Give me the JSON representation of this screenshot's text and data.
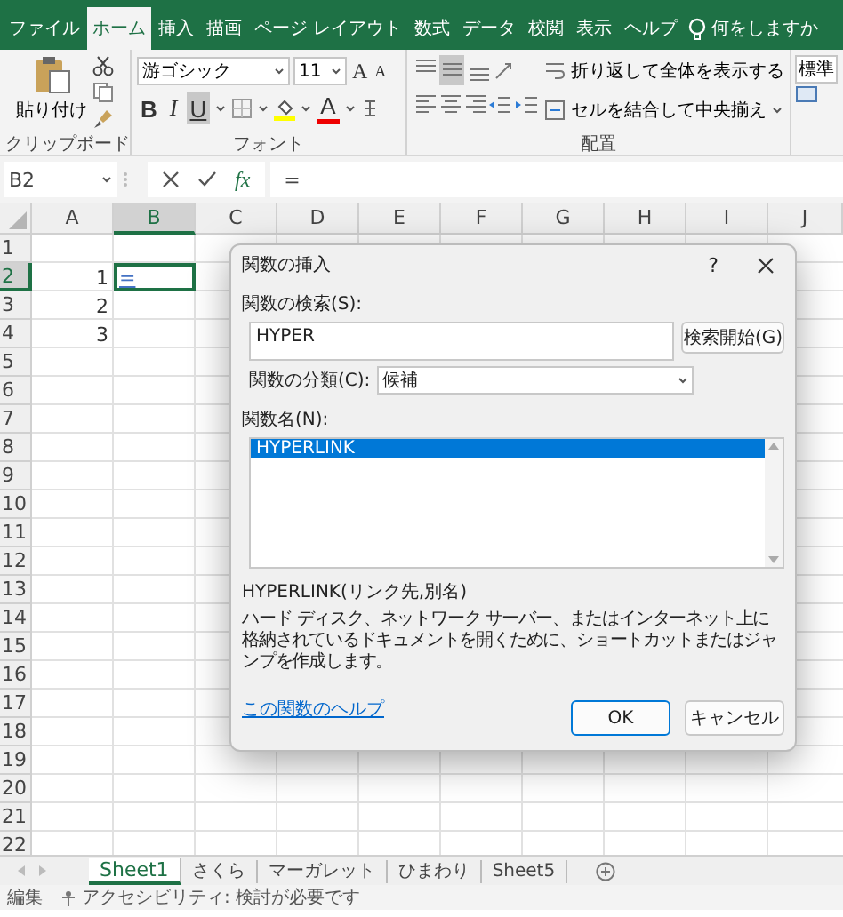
{
  "ribbon_tabs": [
    {
      "label": "ファイル",
      "selected": false
    },
    {
      "label": "ホーム",
      "selected": true
    },
    {
      "label": "挿入",
      "selected": false
    },
    {
      "label": "描画",
      "selected": false
    },
    {
      "label": "ページ レイアウト",
      "selected": false
    },
    {
      "label": "数式",
      "selected": false
    },
    {
      "label": "データ",
      "selected": false
    },
    {
      "label": "校閲",
      "selected": false
    },
    {
      "label": "表示",
      "selected": false
    },
    {
      "label": "ヘルプ",
      "selected": false
    }
  ],
  "tell_me": "何をしますか",
  "clipboard": {
    "paste": "貼り付け",
    "label": "クリップボード"
  },
  "font": {
    "name": "游ゴシック",
    "size": "11",
    "grow": "A",
    "shrink": "A",
    "bold": "B",
    "italic": "I",
    "underline": {
      "label": "U",
      "selected": true
    },
    "font_color": "A",
    "label": "フォント"
  },
  "alignment": {
    "vertical": [
      {
        "kind": "top",
        "selected": false
      },
      {
        "kind": "middle",
        "selected": true
      },
      {
        "kind": "bottom",
        "selected": false
      }
    ],
    "wrap": "折り返して全体を表示する",
    "merge": "セルを結合して中央揃え",
    "label": "配置"
  },
  "number": {
    "format": "標準"
  },
  "formula_bar": {
    "name_box": "B2",
    "fx": "fx",
    "formula": "="
  },
  "grid": {
    "columns": [
      {
        "label": "A",
        "selected": false
      },
      {
        "label": "B",
        "selected": true
      },
      {
        "label": "C",
        "selected": false
      },
      {
        "label": "D",
        "selected": false
      },
      {
        "label": "E",
        "selected": false
      },
      {
        "label": "F",
        "selected": false
      },
      {
        "label": "G",
        "selected": false
      },
      {
        "label": "H",
        "selected": false
      },
      {
        "label": "I",
        "selected": false
      },
      {
        "label": "J",
        "selected": false
      }
    ],
    "rows": [
      {
        "number": "1",
        "selected": false
      },
      {
        "number": "2",
        "selected": true,
        "cells": [
          "1",
          "="
        ]
      },
      {
        "number": "3",
        "selected": false,
        "cells": [
          "2"
        ]
      },
      {
        "number": "4",
        "selected": false,
        "cells": [
          "3"
        ]
      },
      {
        "number": "5",
        "selected": false
      },
      {
        "number": "6",
        "selected": false
      },
      {
        "number": "7",
        "selected": false
      },
      {
        "number": "8",
        "selected": false
      },
      {
        "number": "9",
        "selected": false
      },
      {
        "number": "10",
        "selected": false
      },
      {
        "number": "11",
        "selected": false
      },
      {
        "number": "12",
        "selected": false
      },
      {
        "number": "13",
        "selected": false
      },
      {
        "number": "14",
        "selected": false
      },
      {
        "number": "15",
        "selected": false
      },
      {
        "number": "16",
        "selected": false
      },
      {
        "number": "17",
        "selected": false
      },
      {
        "number": "18",
        "selected": false
      },
      {
        "number": "19",
        "selected": false
      },
      {
        "number": "20",
        "selected": false
      },
      {
        "number": "21",
        "selected": false
      },
      {
        "number": "22",
        "selected": false
      }
    ]
  },
  "dialog": {
    "title": "関数の挿入",
    "help": "?",
    "search_label": "関数の検索(S):",
    "search_value": "HYPER",
    "search_button": "検索開始(G)",
    "category_label": "関数の分類(C):",
    "category_value": "候補",
    "list_label": "関数名(N):",
    "functions": [
      {
        "name": "HYPERLINK",
        "selected": true
      }
    ],
    "signature": "HYPERLINK(リンク先,別名)",
    "description": "ハード ディスク、ネットワーク サーバー、またはインターネット上に格納されているドキュメントを開くために、ショートカットまたはジャンプを作成します。",
    "help_link": "この関数のヘルプ",
    "ok": "OK",
    "cancel": "キャンセル"
  },
  "sheet_tabs": [
    {
      "label": "Sheet1",
      "selected": true
    },
    {
      "label": "さくら",
      "selected": false
    },
    {
      "label": "マーガレット",
      "selected": false
    },
    {
      "label": "ひまわり",
      "selected": false
    },
    {
      "label": "Sheet5",
      "selected": false
    }
  ],
  "status_bar": {
    "mode": "編集",
    "accessibility": "アクセシビリティ: 検討が必要です"
  }
}
